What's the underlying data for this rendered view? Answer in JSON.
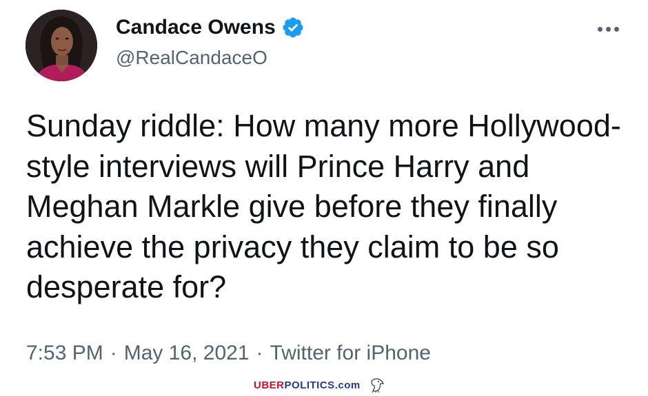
{
  "tweet": {
    "author": {
      "display_name": "Candace Owens",
      "handle": "@RealCandaceO",
      "verified": true,
      "avatar_icon": "profile-photo"
    },
    "more_icon": "more-horizontal-icon",
    "text": "Sunday riddle: How many more Hollywood-style interviews will Prince Harry and Meghan Markle give before they finally achieve the privacy they claim to be so desperate for?",
    "time": "7:53 PM",
    "separator": "·",
    "date": "May 16, 2021",
    "source": "Twitter for iPhone"
  },
  "watermark": {
    "part1": "UBER",
    "part2": "POLITICS",
    "part3": ".com",
    "icon": "eagle-icon"
  },
  "colors": {
    "verified_blue": "#1d9bf0",
    "text_primary": "#0f1419",
    "text_secondary": "#536471",
    "watermark_red": "#c8102e",
    "watermark_blue": "#1f3a93"
  }
}
